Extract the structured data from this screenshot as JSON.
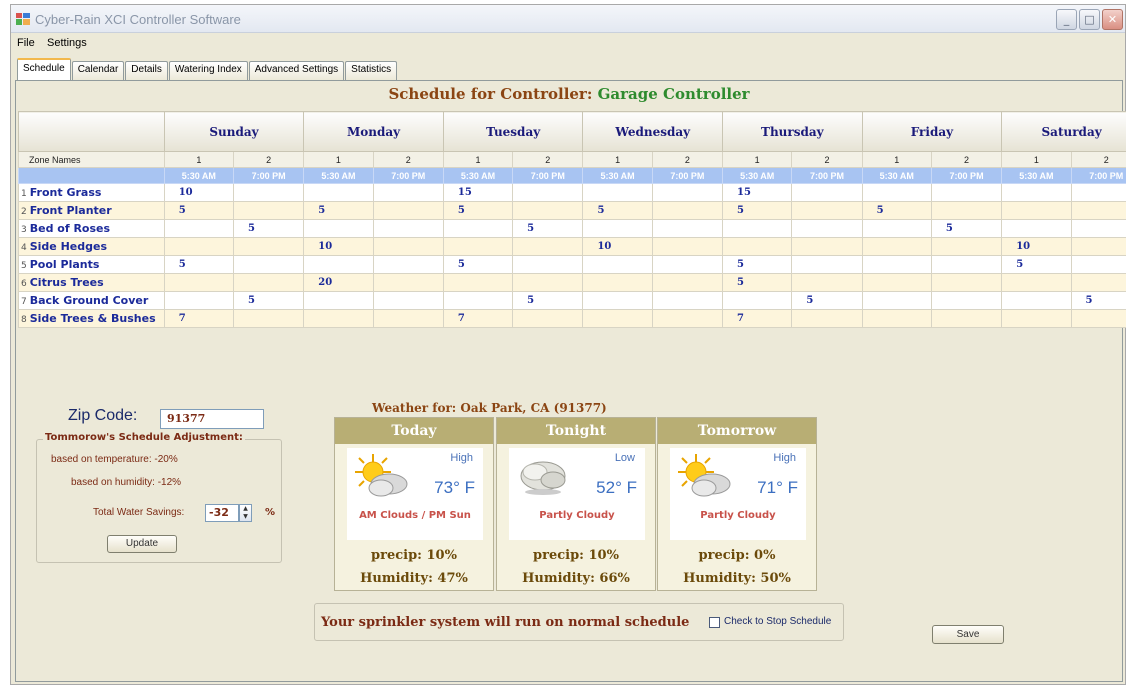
{
  "window": {
    "title": "Cyber-Rain XCI Controller Software"
  },
  "menu": [
    "File",
    "Settings"
  ],
  "tabs": [
    "Schedule",
    "Calendar",
    "Details",
    "Watering Index",
    "Advanced Settings",
    "Statistics"
  ],
  "schedule": {
    "title_prefix": "Schedule for Controller:",
    "controller_name": "Garage Controller",
    "zone_names_header": "Zone Names",
    "days": [
      "Sunday",
      "Monday",
      "Tuesday",
      "Wednesday",
      "Thursday",
      "Friday",
      "Saturday"
    ],
    "slot_numbers": [
      "1",
      "2",
      "1",
      "2",
      "1",
      "2",
      "1",
      "2",
      "1",
      "2",
      "1",
      "2",
      "1",
      "2"
    ],
    "times": [
      "5:30 AM",
      "7:00 PM",
      "5:30 AM",
      "7:00 PM",
      "5:30 AM",
      "7:00 PM",
      "5:30 AM",
      "7:00 PM",
      "5:30 AM",
      "7:00 PM",
      "5:30 AM",
      "7:00 PM",
      "5:30 AM",
      "7:00 PM"
    ],
    "zones": [
      {
        "num": "1",
        "name": "Front Grass",
        "values": [
          "10",
          "",
          "",
          "",
          "15",
          "",
          "",
          "",
          "15",
          "",
          "",
          "",
          "",
          ""
        ]
      },
      {
        "num": "2",
        "name": "Front Planter",
        "values": [
          "5",
          "",
          "5",
          "",
          "5",
          "",
          "5",
          "",
          "5",
          "",
          "5",
          "",
          "",
          ""
        ]
      },
      {
        "num": "3",
        "name": "Bed of Roses",
        "values": [
          "",
          "5",
          "",
          "",
          "",
          "5",
          "",
          "",
          "",
          "",
          "",
          "5",
          "",
          ""
        ]
      },
      {
        "num": "4",
        "name": "Side Hedges",
        "values": [
          "",
          "",
          "10",
          "",
          "",
          "",
          "10",
          "",
          "",
          "",
          "",
          "",
          "10",
          ""
        ]
      },
      {
        "num": "5",
        "name": "Pool Plants",
        "values": [
          "5",
          "",
          "",
          "",
          "5",
          "",
          "",
          "",
          "5",
          "",
          "",
          "",
          "5",
          ""
        ]
      },
      {
        "num": "6",
        "name": "Citrus Trees",
        "values": [
          "",
          "",
          "20",
          "",
          "",
          "",
          "",
          "",
          "5",
          "",
          "",
          "",
          "",
          ""
        ]
      },
      {
        "num": "7",
        "name": "Back Ground Cover",
        "values": [
          "",
          "5",
          "",
          "",
          "",
          "5",
          "",
          "",
          "",
          "5",
          "",
          "",
          "",
          "5"
        ]
      },
      {
        "num": "8",
        "name": "Side Trees & Bushes",
        "values": [
          "7",
          "",
          "",
          "",
          "7",
          "",
          "",
          "",
          "7",
          "",
          "",
          "",
          "",
          ""
        ]
      }
    ]
  },
  "zip": {
    "label": "Zip Code:",
    "value": "91377"
  },
  "adjustment": {
    "title": "Tommorow's Schedule Adjustment:",
    "temperature": "based on temperature: -20%",
    "humidity": "based on humidity: -12%",
    "savings_label": "Total Water Savings:",
    "savings_value": "-32",
    "percent": "%",
    "update_button": "Update"
  },
  "weather": {
    "heading": "Weather for: Oak Park, CA (91377)",
    "cards": [
      {
        "title": "Today",
        "hl": "High",
        "temp": "73° F",
        "condition": "AM Clouds / PM Sun",
        "precip": "precip: 10%",
        "humidity": "Humidity: 47%",
        "icon": "partly-sunny-icon"
      },
      {
        "title": "Tonight",
        "hl": "Low",
        "temp": "52° F",
        "condition": "Partly Cloudy",
        "precip": "precip: 10%",
        "humidity": "Humidity: 66%",
        "icon": "cloudy-night-icon"
      },
      {
        "title": "Tomorrow",
        "hl": "High",
        "temp": "71° F",
        "condition": "Partly Cloudy",
        "precip": "precip: 0%",
        "humidity": "Humidity: 50%",
        "icon": "partly-sunny-icon"
      }
    ]
  },
  "status": {
    "message": "Your sprinkler system will run on normal schedule",
    "checkbox_label": "Check to Stop Schedule",
    "checked": false
  },
  "save_button": "Save"
}
